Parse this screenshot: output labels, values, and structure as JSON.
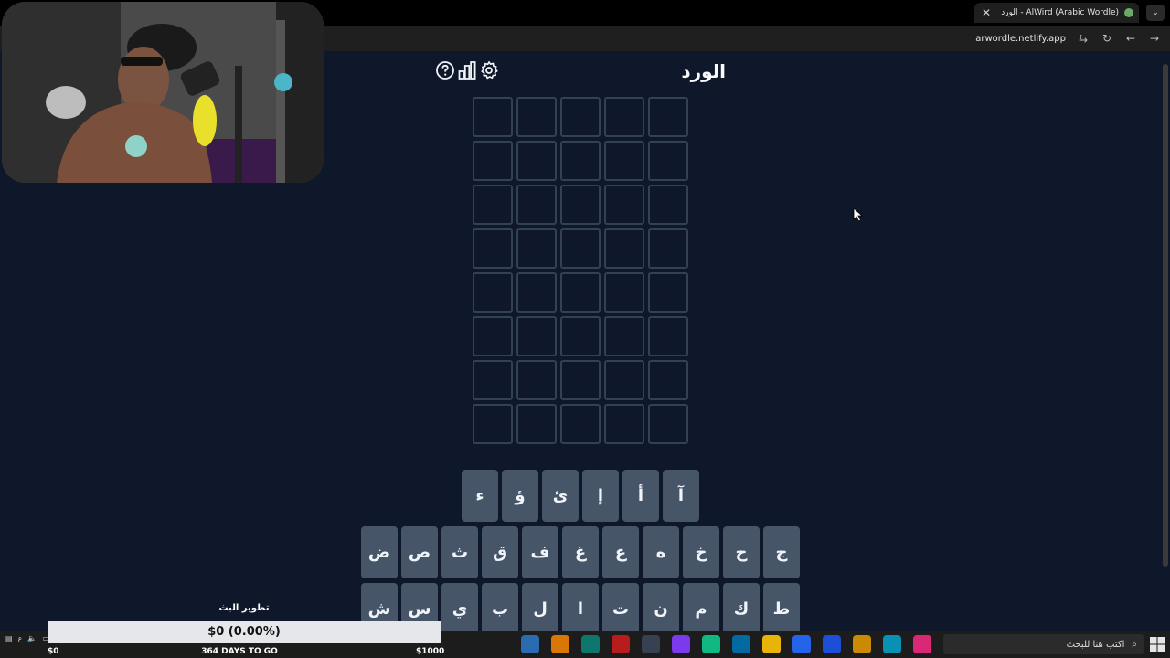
{
  "browser": {
    "tab_title": "الورد - AlWird (Arabic Wordle)",
    "tab_close_label": "✕",
    "new_tab_label": "+",
    "url": "arwordle.netlify.app"
  },
  "app": {
    "title": "الورد",
    "board": {
      "rows": 8,
      "cols": 5
    },
    "keyboard": {
      "row1": [
        "آ",
        "أ",
        "إ",
        "ئ",
        "ؤ",
        "ء"
      ],
      "row2": [
        "ج",
        "ح",
        "خ",
        "ه",
        "ع",
        "غ",
        "ف",
        "ق",
        "ث",
        "ص",
        "ض"
      ],
      "row3": [
        "ط",
        "ك",
        "م",
        "ن",
        "ت",
        "ا",
        "ل",
        "ب",
        "ي",
        "س",
        "ش"
      ]
    },
    "colors": {
      "background": "#0f172a",
      "tile_border": "#334155",
      "key_bg": "#475569"
    }
  },
  "stream_overlay": {
    "donation_label": "تطوير البث",
    "donation_amount": "$0 (0.00%)",
    "goal_min": "$0",
    "goal_days": "364 DAYS TO GO",
    "goal_max": "$1000"
  },
  "taskbar": {
    "search_placeholder": "اكتب هنا للبحث"
  }
}
